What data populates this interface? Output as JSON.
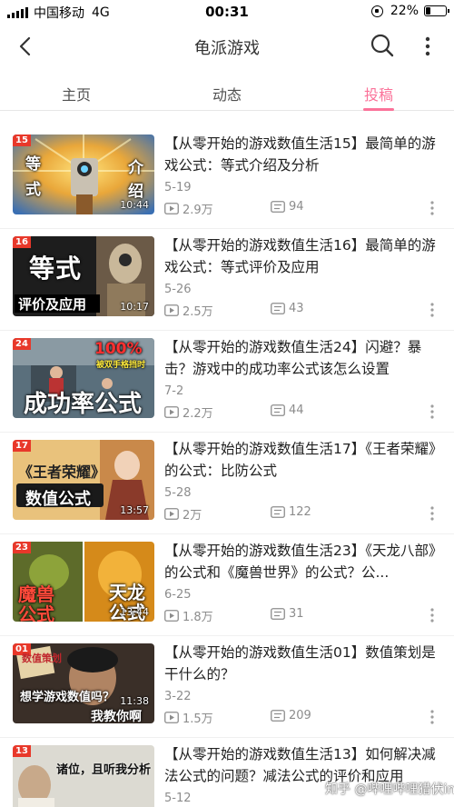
{
  "status_bar": {
    "carrier": "中国移动",
    "network": "4G",
    "time": "00:31",
    "battery": "22%",
    "battery_fraction": 0.22
  },
  "header": {
    "title": "龟派游戏"
  },
  "tabs": [
    {
      "label": "主页",
      "active": false
    },
    {
      "label": "动态",
      "active": false
    },
    {
      "label": "投稿",
      "active": true
    }
  ],
  "videos": [
    {
      "episode": "15",
      "thumb_lines": [
        "等",
        "式",
        "介",
        "绍"
      ],
      "duration": "10:44",
      "title": "【从零开始的游戏数值生活15】最简单的游戏公式：等式介绍及分析",
      "date": "5-19",
      "plays": "2.9万",
      "danmaku": "94"
    },
    {
      "episode": "16",
      "thumb_lines": [
        "等式",
        "评价及应用"
      ],
      "duration": "10:17",
      "title": "【从零开始的游戏数值生活16】最简单的游戏公式：等式评价及应用",
      "date": "5-26",
      "plays": "2.5万",
      "danmaku": "43"
    },
    {
      "episode": "24",
      "thumb_lines": [
        "100%",
        "被双手格挡时",
        "成功率公式"
      ],
      "duration": "",
      "title": "【从零开始的游戏数值生活24】闪避？暴击？游戏中的成功率公式该怎么设置",
      "date": "7-2",
      "plays": "2.2万",
      "danmaku": "44"
    },
    {
      "episode": "17",
      "thumb_lines": [
        "《王者荣耀》",
        "数值公式"
      ],
      "duration": "13:57",
      "title": "【从零开始的游戏数值生活17】《王者荣耀》的公式：比防公式",
      "date": "5-28",
      "plays": "2万",
      "danmaku": "122"
    },
    {
      "episode": "23",
      "thumb_lines": [
        "魔兽",
        "公式",
        "天龙",
        "公式"
      ],
      "duration": "13:44",
      "title": "【从零开始的游戏数值生活23】《天龙八部》的公式和《魔兽世界》的公式？公...",
      "date": "6-25",
      "plays": "1.8万",
      "danmaku": "31"
    },
    {
      "episode": "01",
      "thumb_lines": [
        "数值策划",
        "想学游戏数值吗？",
        "我教你啊"
      ],
      "duration": "11:38",
      "title": "【从零开始的游戏数值生活01】数值策划是干什么的？",
      "date": "3-22",
      "plays": "1.5万",
      "danmaku": "209"
    },
    {
      "episode": "13",
      "thumb_lines": [
        "诸位，且听我分析"
      ],
      "duration": "",
      "title": "【从零开始的游戏数值生活13】如何解决减法公式的问题？减法公式的评价和应用",
      "date": "5-12",
      "plays": "",
      "danmaku": ""
    }
  ],
  "watermark": "知乎 @哔哩哔哩猎伏ing",
  "colors": {
    "accent": "#fb7299",
    "badge": "#e8382a",
    "meta": "#8c8c8c"
  },
  "icons": [
    "back-icon",
    "search-icon",
    "more-icon",
    "play-icon",
    "danmaku-icon"
  ]
}
